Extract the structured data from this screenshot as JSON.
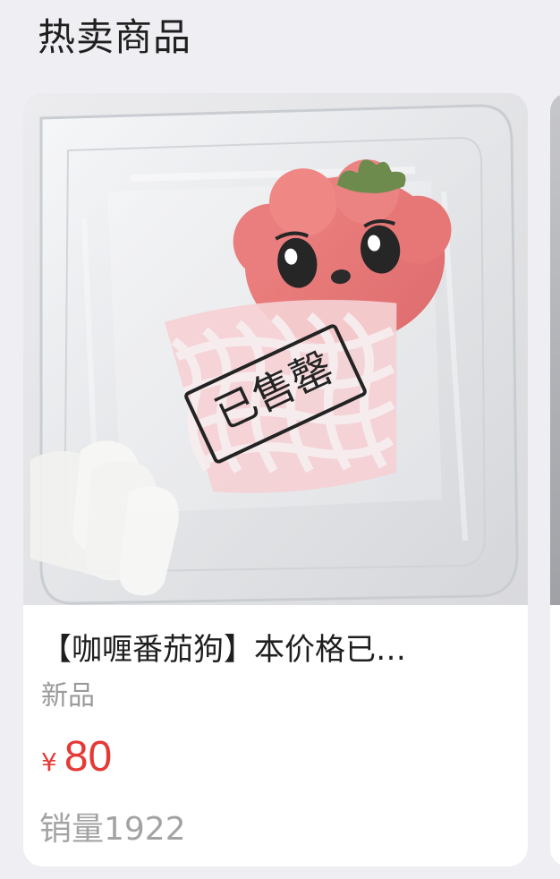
{
  "section": {
    "title": "热卖商品"
  },
  "product": {
    "title": "【咖喱番茄狗】本价格已…",
    "tag": "新品",
    "currency": "¥",
    "price": "80",
    "sales": "销量1922",
    "image": {
      "description": "tomato-dog-plush-in-clear-box",
      "stamp_text": "已售罄"
    }
  },
  "colors": {
    "page_background": "#efeff3",
    "card_background": "#ffffff",
    "price": "#e53935",
    "muted_text": "#9a9a9a",
    "title_text": "#1f1f1f"
  }
}
